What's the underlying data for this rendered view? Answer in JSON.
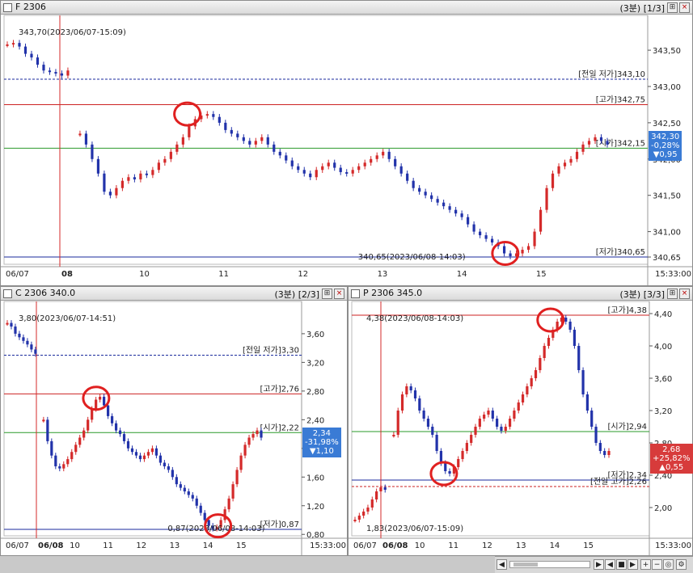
{
  "panels": [
    {
      "id": "f",
      "title": "F 2306",
      "meta": "(3분) [1/3]",
      "ymin": 340.55,
      "ymax": 343.98,
      "digits": 2,
      "yticks": [
        340.65,
        341.0,
        341.5,
        342.0,
        342.5,
        343.0,
        343.5
      ],
      "ylabels": [
        "340,65",
        "341,00",
        "341,50",
        "342,00",
        "342,50",
        "343,00",
        "343,50"
      ],
      "refs": [
        {
          "label": "[전일 저가]343,10",
          "v": 343.1,
          "color": "#1a2a9c",
          "dash": true
        },
        {
          "label": "[고가]342,75",
          "v": 342.75,
          "color": "#cc2222",
          "dash": false
        },
        {
          "label": "[시가]342,15",
          "v": 342.15,
          "color": "#2a9a2a",
          "dash": false
        },
        {
          "label": "[저가]340,65",
          "v": 340.65,
          "color": "#1a2a9c",
          "dash": false
        }
      ],
      "annot_hi": "343,70(2023/06/07-15:09)",
      "annot_lo": "340,65(2023/06/08-14:03)",
      "xlabels": [
        "06/07",
        "08",
        "10",
        "11",
        "12",
        "13",
        "14",
        "15",
        "15:33:00"
      ],
      "badge": {
        "lines": [
          "342,30",
          "-0,28%",
          "▼0,95"
        ],
        "color": "#3a7bd5",
        "v": 342.2
      },
      "path": [
        343.58,
        343.6,
        343.55,
        343.45,
        343.4,
        343.3,
        343.22,
        343.2,
        343.18,
        343.15,
        343.22,
        null,
        342.35,
        342.2,
        342.0,
        341.8,
        341.55,
        341.5,
        341.6,
        341.7,
        341.75,
        341.72,
        341.8,
        341.78,
        341.85,
        341.95,
        342.0,
        342.1,
        342.2,
        342.3,
        342.45,
        342.55,
        342.6,
        342.62,
        342.58,
        342.5,
        342.4,
        342.35,
        342.3,
        342.25,
        342.2,
        342.25,
        342.3,
        342.2,
        342.1,
        342.05,
        341.98,
        341.9,
        341.85,
        341.8,
        341.75,
        341.85,
        341.9,
        341.95,
        341.88,
        341.82,
        341.8,
        341.85,
        341.9,
        341.95,
        342.0,
        342.05,
        342.1,
        342.0,
        341.9,
        341.8,
        341.7,
        341.6,
        341.55,
        341.5,
        341.45,
        341.4,
        341.35,
        341.3,
        341.25,
        341.2,
        341.1,
        341.0,
        340.95,
        340.9,
        340.85,
        340.8,
        340.7,
        340.66,
        340.7,
        340.75,
        340.8,
        341.0,
        341.3,
        341.6,
        341.8,
        341.9,
        341.95,
        342.0,
        342.1,
        342.2,
        342.25,
        342.3,
        342.25,
        342.2
      ],
      "circles": [
        {
          "t": 0.3,
          "v": 342.62
        },
        {
          "t": 0.83,
          "v": 340.7
        }
      ]
    },
    {
      "id": "c",
      "title": "C 2306 340.0",
      "meta": "(3분) [2/3]",
      "ymin": 0.78,
      "ymax": 4.05,
      "digits": 2,
      "yticks": [
        0.8,
        1.2,
        1.6,
        2.0,
        2.4,
        2.8,
        3.2,
        3.6
      ],
      "ylabels": [
        "0,80",
        "1,20",
        "1,60",
        "2,00",
        "2,40",
        "2,80",
        "3,20",
        "3,60"
      ],
      "refs": [
        {
          "label": "[전일 저가]3,30",
          "v": 3.3,
          "color": "#1a2a9c",
          "dash": true
        },
        {
          "label": "[고가]2,76",
          "v": 2.76,
          "color": "#cc2222",
          "dash": false
        },
        {
          "label": "[시가]2,22",
          "v": 2.22,
          "color": "#2a9a2a",
          "dash": false
        },
        {
          "label": "[저가]0,87",
          "v": 0.87,
          "color": "#1a2a9c",
          "dash": false
        }
      ],
      "annot_hi": "3,80(2023/06/07-14:51)",
      "annot_lo": "0,87(2023/06/08-14:03)",
      "xlabels": [
        "06/07",
        "06/08",
        "10",
        "11",
        "12",
        "13",
        "14",
        "15",
        "15:33:00"
      ],
      "badge": {
        "lines": [
          "2,34",
          "-31,98%",
          "▼1,10"
        ],
        "color": "#3a7bd5",
        "v": 2.1
      },
      "path": [
        3.75,
        3.7,
        3.6,
        3.55,
        3.5,
        3.45,
        3.38,
        3.32,
        null,
        2.4,
        2.1,
        1.9,
        1.75,
        1.72,
        1.78,
        1.85,
        1.95,
        2.05,
        2.15,
        2.25,
        2.4,
        2.55,
        2.68,
        2.72,
        2.6,
        2.45,
        2.35,
        2.25,
        2.2,
        2.1,
        2.0,
        1.95,
        1.9,
        1.85,
        1.9,
        1.95,
        2.0,
        1.9,
        1.8,
        1.75,
        1.7,
        1.6,
        1.5,
        1.45,
        1.4,
        1.35,
        1.3,
        1.2,
        1.1,
        1.0,
        0.92,
        0.88,
        0.9,
        1.0,
        1.15,
        1.3,
        1.5,
        1.7,
        1.9,
        2.05,
        2.15,
        2.2,
        2.25,
        2.15
      ],
      "circles": [
        {
          "t": 0.35,
          "v": 2.7
        },
        {
          "t": 0.83,
          "v": 0.92
        }
      ]
    },
    {
      "id": "p",
      "title": "P 2306 345.0",
      "meta": "(3분) [3/3]",
      "ymin": 1.65,
      "ymax": 4.55,
      "digits": 2,
      "yticks": [
        2.0,
        2.4,
        2.8,
        3.2,
        3.6,
        4.0,
        4.4
      ],
      "ylabels": [
        "2,00",
        "2,40",
        "2,80",
        "3,20",
        "3,60",
        "4,00",
        "4,40"
      ],
      "refs": [
        {
          "label": "[고가]4,38",
          "v": 4.38,
          "color": "#cc2222",
          "dash": false
        },
        {
          "label": "[시가]2,94",
          "v": 2.94,
          "color": "#2a9a2a",
          "dash": false
        },
        {
          "label": "[저가]2,34",
          "v": 2.34,
          "color": "#1a2a9c",
          "dash": false
        },
        {
          "label": "[전일 고가]2,26",
          "v": 2.26,
          "color": "#cc2222",
          "dash": true
        }
      ],
      "annot_hi": "4,38(2023/06/08-14:03)",
      "annot_lo": "1,83(2023/06/07-15:09)",
      "xlabels": [
        "06/07",
        "06/08",
        "10",
        "11",
        "12",
        "13",
        "14",
        "15",
        "15:33:00"
      ],
      "badge": {
        "lines": [
          "2,68",
          "+25,82%",
          "▲0,55"
        ],
        "color": "#d73b3b",
        "v": 2.62
      },
      "path": [
        1.85,
        1.9,
        1.95,
        2.0,
        2.1,
        2.2,
        2.25,
        2.22,
        null,
        2.9,
        3.2,
        3.4,
        3.5,
        3.45,
        3.35,
        3.2,
        3.1,
        3.0,
        2.9,
        2.7,
        2.55,
        2.45,
        2.42,
        2.5,
        2.6,
        2.7,
        2.8,
        2.9,
        3.0,
        3.1,
        3.15,
        3.2,
        3.1,
        3.0,
        2.95,
        3.0,
        3.1,
        3.2,
        3.3,
        3.4,
        3.5,
        3.6,
        3.7,
        3.85,
        4.0,
        4.1,
        4.2,
        4.3,
        4.35,
        4.3,
        4.2,
        4.0,
        3.7,
        3.4,
        3.2,
        3.0,
        2.8,
        2.7,
        2.65,
        2.7
      ],
      "circles": [
        {
          "t": 0.35,
          "v": 2.42
        },
        {
          "t": 0.77,
          "v": 4.32
        }
      ]
    }
  ],
  "colors": {
    "up": "#d42a2a",
    "down": "#2233aa",
    "grid": "#7b7bd6",
    "vline": "#d42a2a",
    "circle": "#e02020"
  },
  "scrollbar": {
    "icons": [
      "zoom-in-icon",
      "zoom-out-icon",
      "zoom-fit-icon",
      "search-icon",
      "settings-icon"
    ]
  }
}
